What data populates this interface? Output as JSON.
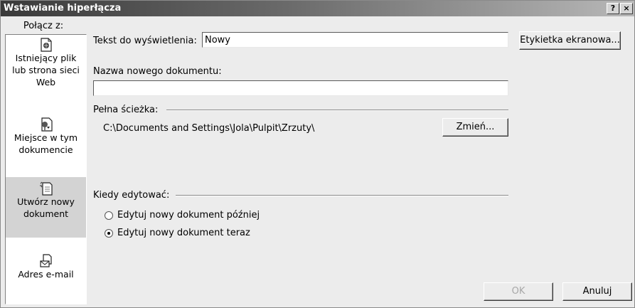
{
  "window": {
    "title": "Wstawianie hiperłącza",
    "help_glyph": "?",
    "close_glyph": "×"
  },
  "sidebar": {
    "header": "Połącz z:",
    "items": [
      {
        "label_lines": [
          "Istniejący plik",
          "lub strona sieci",
          "Web"
        ],
        "icon": "web-page-icon",
        "active": false
      },
      {
        "label_lines": [
          "Miejsce w tym",
          "dokumencie"
        ],
        "icon": "place-in-document-icon",
        "active": false
      },
      {
        "label_lines": [
          "Utwórz nowy",
          "dokument"
        ],
        "icon": "new-document-icon",
        "active": true
      },
      {
        "label_lines": [
          "Adres e-mail"
        ],
        "icon": "email-address-icon",
        "active": false
      }
    ]
  },
  "display_text": {
    "label": "Tekst do wyświetlenia:",
    "value": "Nowy"
  },
  "screentip_button": "Etykietka ekranowa...",
  "new_document": {
    "name_label": "Nazwa nowego dokumentu:",
    "name_value": ""
  },
  "full_path": {
    "label": "Pełna ścieżka:",
    "value": "C:\\Documents and Settings\\Jola\\Pulpit\\Zrzuty\\",
    "change_button": "Zmień..."
  },
  "edit_when": {
    "label": "Kiedy edytować:",
    "options": [
      {
        "label": "Edytuj nowy dokument później",
        "checked": false
      },
      {
        "label": "Edytuj nowy dokument teraz",
        "checked": true
      }
    ]
  },
  "buttons": {
    "ok": "OK",
    "cancel": "Anuluj"
  }
}
